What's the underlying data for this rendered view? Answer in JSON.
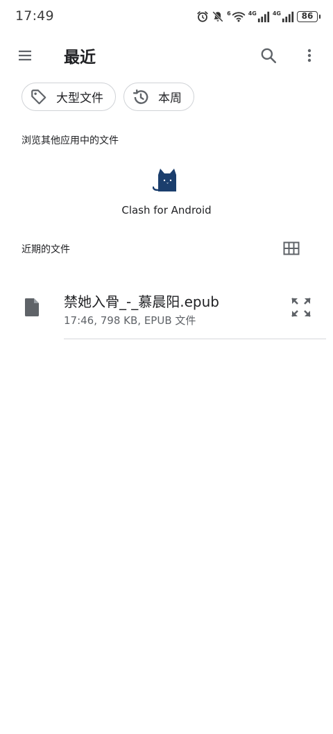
{
  "status_bar": {
    "time": "17:49",
    "signal_1_label": "4G",
    "signal_2_label": "4G",
    "wifi_label": "6",
    "battery": "86",
    "icons": [
      "alarm-icon",
      "mute-icon",
      "wifi-icon",
      "signal-icon",
      "signal-icon",
      "battery-icon"
    ]
  },
  "app_bar": {
    "title": "最近",
    "icons": [
      "menu-icon",
      "search-icon",
      "more-vert-icon"
    ]
  },
  "chips": [
    {
      "label": "大型文件",
      "icon": "tag-icon"
    },
    {
      "label": "本周",
      "icon": "history-icon"
    }
  ],
  "browse_section": {
    "label": "浏览其他应用中的文件",
    "apps": [
      {
        "name": "Clash for Android",
        "icon": "clash-cat-icon",
        "color": "#1b3e6d"
      }
    ]
  },
  "recent_section": {
    "label": "近期的文件",
    "view_toggle_icon": "grid-view-icon",
    "files": [
      {
        "name": "禁她入骨_-_慕晨阳.epub",
        "meta": "17:46, 798 KB, EPUB 文件",
        "icon": "file-icon",
        "action_icon": "expand-icon"
      }
    ]
  },
  "colors": {
    "text_primary": "#202124",
    "text_secondary": "#5f6368",
    "chip_border": "#cfd2d6",
    "icon_gray": "#5f6368"
  }
}
